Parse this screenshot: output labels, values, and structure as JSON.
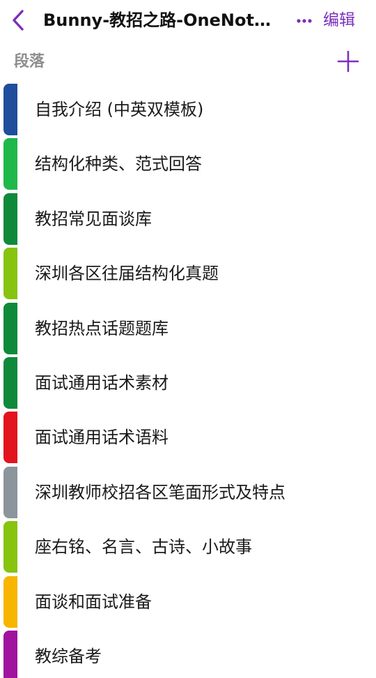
{
  "header": {
    "title": "Bunny-教招之路-OneNote...",
    "edit_label": "编辑",
    "back_icon": "chevron-left-icon",
    "more_icon": "ellipsis-icon",
    "accent_color": "#7c2fbb"
  },
  "section_header": {
    "label": "段落",
    "add_icon": "plus-icon"
  },
  "sections": [
    {
      "label": "自我介绍 (中英双模板)",
      "color": "#1f4e9c"
    },
    {
      "label": "结构化种类、范式回答",
      "color": "#1fb84a"
    },
    {
      "label": "教招常见面谈库",
      "color": "#0f8a3a"
    },
    {
      "label": "深圳各区往届结构化真题",
      "color": "#86c40f"
    },
    {
      "label": "教招热点话题题库",
      "color": "#0f8a3a"
    },
    {
      "label": "面试通用话术素材",
      "color": "#0f8a3a"
    },
    {
      "label": "面试通用话术语料",
      "color": "#e2141e"
    },
    {
      "label": "深圳教师校招各区笔面形式及特点",
      "color": "#8c959c"
    },
    {
      "label": "座右铭、名言、古诗、小故事",
      "color": "#86c40f"
    },
    {
      "label": "面谈和面试准备",
      "color": "#f7b500"
    },
    {
      "label": "教综备考",
      "color": "#a0139e"
    }
  ]
}
